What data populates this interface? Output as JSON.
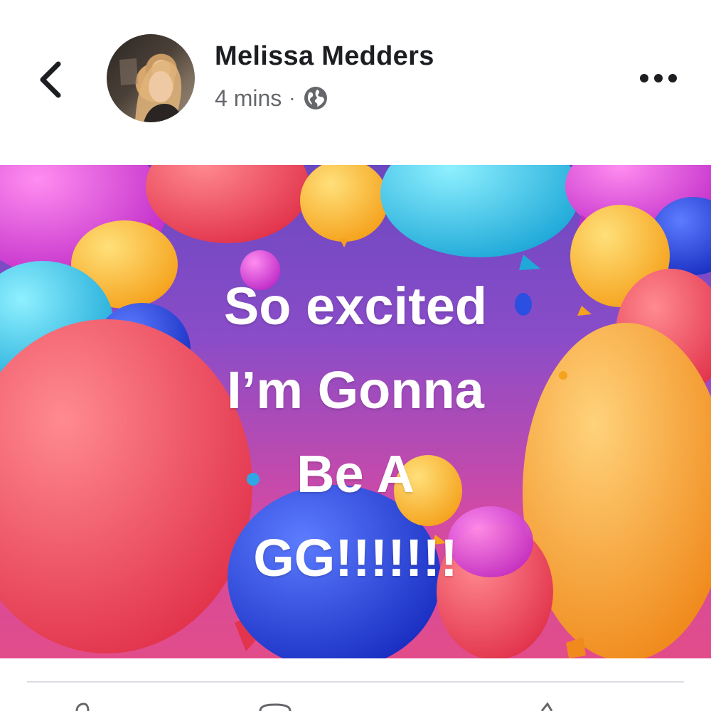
{
  "post": {
    "author": "Melissa Medders",
    "time": "4 mins",
    "separator": "·",
    "visibility_icon": "globe-icon",
    "back_icon": "chevron-left-icon",
    "more_icon": "more-horizontal-icon"
  },
  "image": {
    "text_lines": [
      "So excited",
      "I’m Gonna",
      "Be A",
      "GG!!!!!!!"
    ]
  },
  "colors": {
    "author_text": "#1c1e21",
    "meta_text": "#65676b",
    "divider": "#dadde1"
  }
}
